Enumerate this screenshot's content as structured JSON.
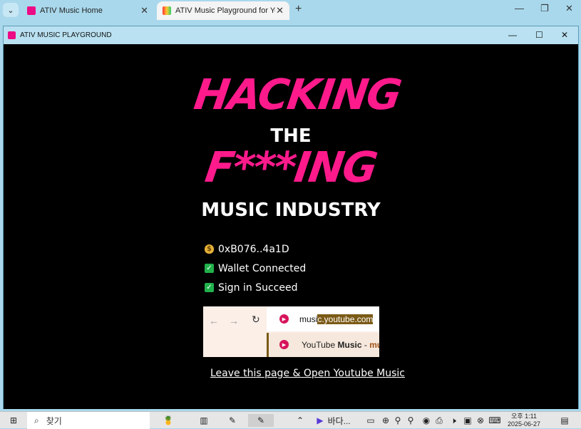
{
  "browser": {
    "tabs": [
      {
        "title": "ATIV Music Home"
      },
      {
        "title": "ATIV Music Playground for You"
      }
    ],
    "new_tab": "+"
  },
  "window": {
    "title": "ATIV MUSIC PLAYGROUND"
  },
  "hero": {
    "line1": "HACKING",
    "line2": "THE",
    "line3": "F***ING",
    "line4": "MUSIC INDUSTRY"
  },
  "status": {
    "wallet_address": "0xB076..4a1D",
    "wallet_connected": "Wallet Connected",
    "sign_in": "Sign in Succeed"
  },
  "preview": {
    "url_typed": "musi",
    "url_completion": "c.youtube.com",
    "suggestion_prefix": "YouTube ",
    "suggestion_bold": "Music",
    "suggestion_suffix": " - ",
    "suggestion_trail": "mu"
  },
  "link": {
    "leave": "Leave this page & Open Youtube Music"
  },
  "taskbar": {
    "search_label": "찾기",
    "app_label": "바다...",
    "time": "오후 1:11",
    "date": "2025-06-27"
  },
  "colors": {
    "accent_pink": "#ff1a8c",
    "titlebar": "#b9e1f1",
    "check_green": "#22b14c"
  }
}
